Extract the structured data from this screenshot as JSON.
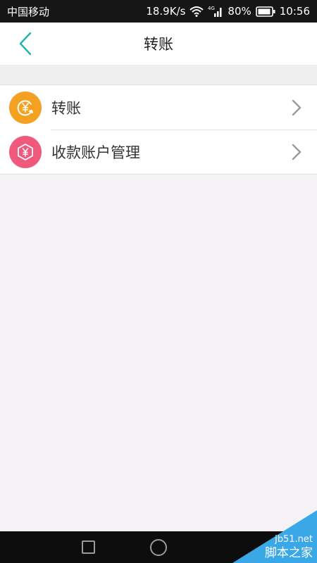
{
  "status_bar": {
    "carrier": "中国移动",
    "speed": "18.9K/s",
    "network": "4G",
    "battery": "80%",
    "time": "10:56",
    "icons": [
      "wifi-icon",
      "signal-icon",
      "battery-icon"
    ]
  },
  "header": {
    "title": "转账",
    "back_icon": "chevron-left-icon",
    "accent_color": "#1fb5ad"
  },
  "menu": {
    "items": [
      {
        "label": "转账",
        "icon": "yuan-transfer-icon",
        "icon_color": "#f4a020"
      },
      {
        "label": "收款账户管理",
        "icon": "yuan-hexagon-icon",
        "icon_color": "#ef5a7c"
      }
    ]
  },
  "nav": {
    "buttons": [
      "recent-apps-icon",
      "home-icon"
    ]
  },
  "watermark": {
    "site": "jb51.net",
    "name": "脚本之家"
  }
}
